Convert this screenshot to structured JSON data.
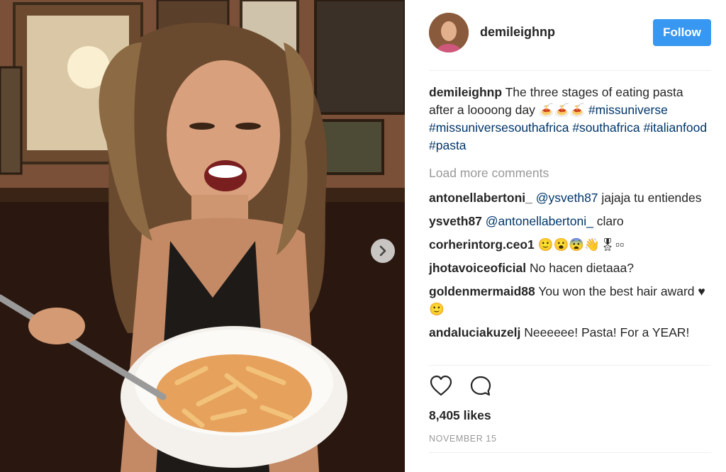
{
  "post": {
    "author": "demileighnp",
    "follow_label": "Follow",
    "caption_user": "demileighnp",
    "caption_text": "The three stages of eating pasta after a loooong day 🍝🍝🍝",
    "hashtags": [
      "#missuniverse",
      "#missuniversesouthafrica",
      "#southafrica",
      "#italianfood",
      "#pasta"
    ],
    "load_more": "Load more comments",
    "comments": [
      {
        "user": "antonellabertoni_",
        "mention": "@ysveth87",
        "text": "jajaja tu entiendes"
      },
      {
        "user": "ysveth87",
        "mention": "@antonellabertoni_",
        "text": "claro"
      },
      {
        "user": "corherintorg.ceo1",
        "mention": "",
        "text": "🙂😮😨👋🎖▫▫"
      },
      {
        "user": "jhotavoiceoficial",
        "mention": "",
        "text": "No hacen dietaaa?"
      },
      {
        "user": "goldenmermaid88",
        "mention": "",
        "text": "You won the best hair award ♥🙂"
      },
      {
        "user": "andaluciakuzelj",
        "mention": "",
        "text": "Neeeeee! Pasta! For a YEAR!"
      }
    ],
    "likes": "8,405 likes",
    "date": "NOVEMBER 15"
  },
  "colors": {
    "link": "#003569",
    "follow": "#3897f0",
    "muted": "#999999"
  },
  "icons": {
    "like": "heart-icon",
    "comment": "comment-bubble-icon",
    "next": "chevron-right-icon"
  }
}
